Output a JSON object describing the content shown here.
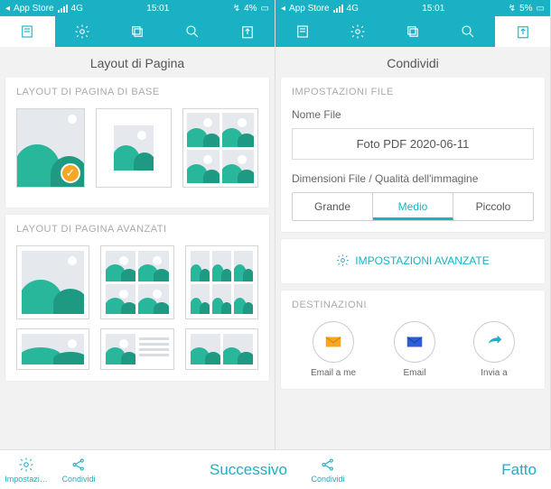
{
  "left": {
    "status": {
      "back": "App Store",
      "net": "4G",
      "time": "15:01",
      "battery": "4%"
    },
    "title": "Layout di Pagina",
    "sections": {
      "basic_header": "LAYOUT DI PAGINA DI BASE",
      "advanced_header": "LAYOUT DI PAGINA AVANZATI"
    },
    "bottom": {
      "settings": "Impostazi…",
      "share": "Condividi",
      "primary": "Successivo"
    }
  },
  "right": {
    "status": {
      "back": "App Store",
      "net": "4G",
      "time": "15:01",
      "battery": "5%"
    },
    "title": "Condividi",
    "file_settings_header": "IMPOSTAZIONI FILE",
    "filename_label": "Nome File",
    "filename_value": "Foto PDF 2020-06-11",
    "quality_label": "Dimensioni File / Qualità dell'immagine",
    "quality": {
      "large": "Grande",
      "medium": "Medio",
      "small": "Piccolo"
    },
    "advanced_link": "IMPOSTAZIONI AVANZATE",
    "destinations_header": "DESTINAZIONI",
    "destinations": {
      "email_me": "Email a me",
      "email": "Email",
      "send_to": "Invia a"
    },
    "bottom": {
      "share": "Condividi",
      "primary": "Fatto"
    }
  }
}
